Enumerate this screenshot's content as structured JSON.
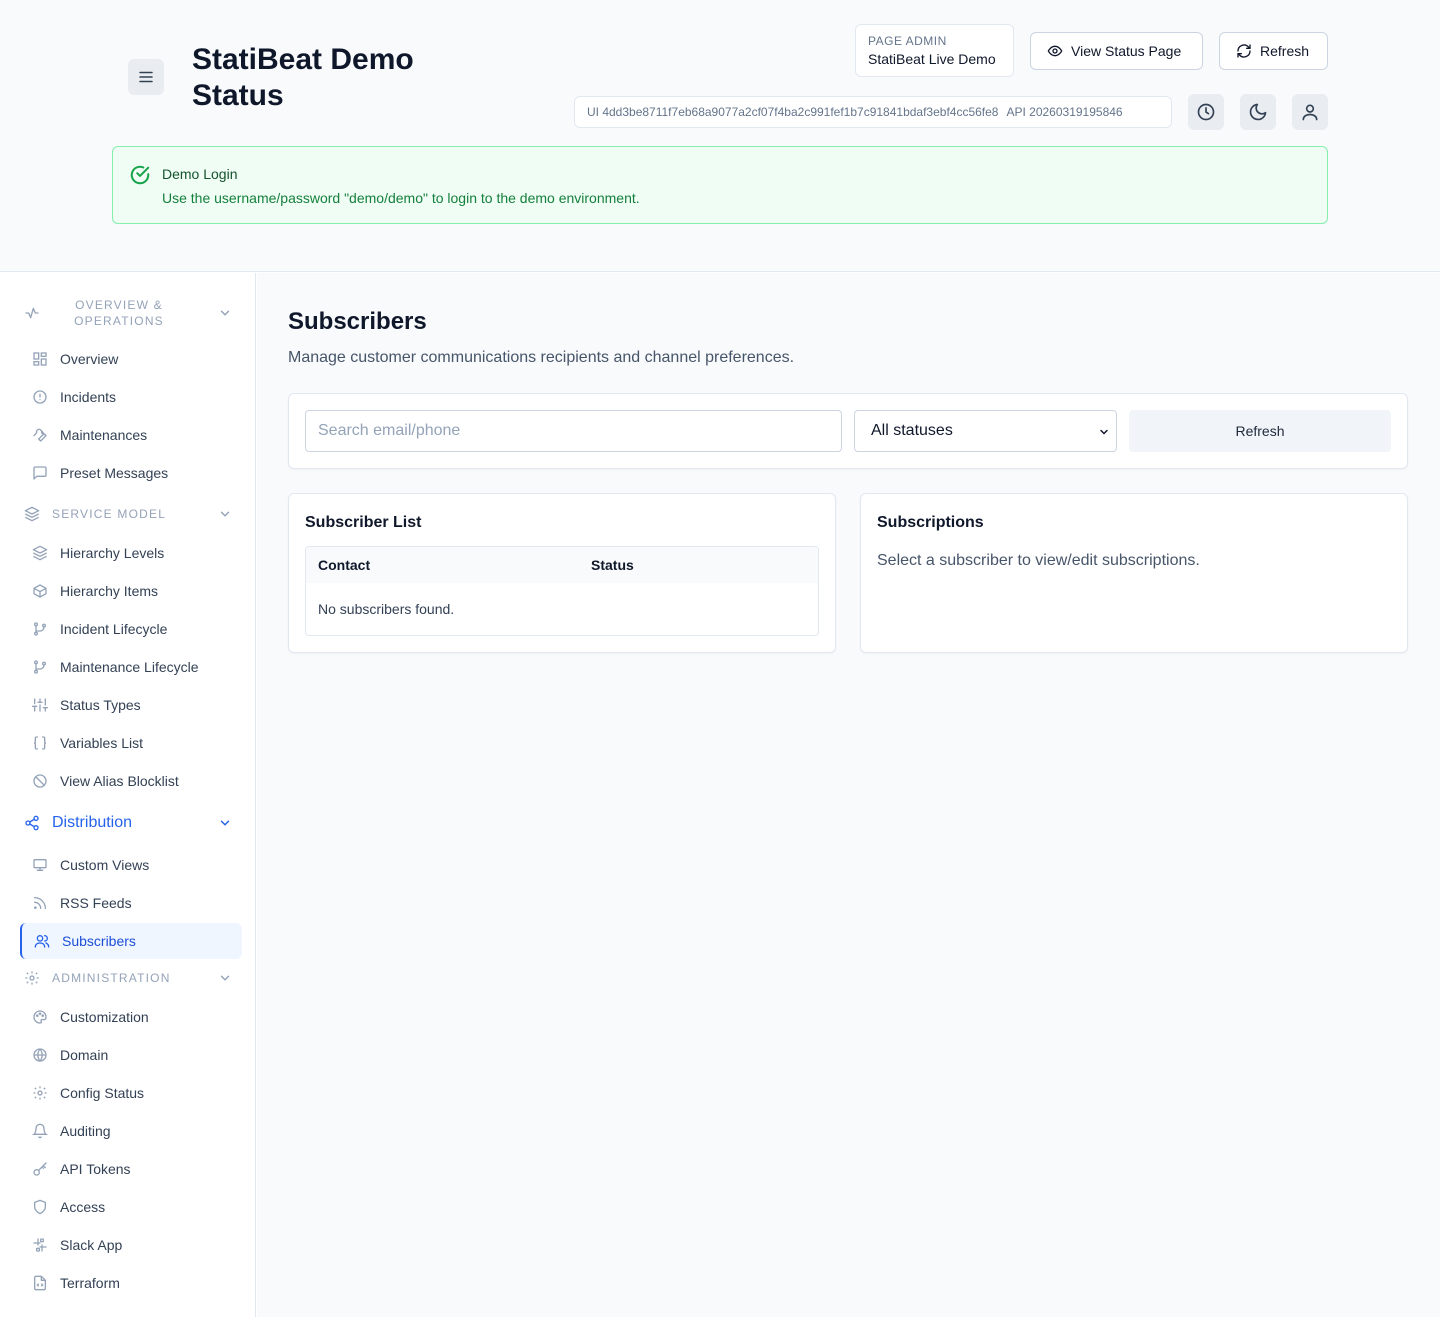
{
  "header": {
    "title": "StatiBeat Demo Status",
    "page_admin_label": "PAGE ADMIN",
    "page_admin_value": "StatiBeat Live Demo",
    "view_status_page": "View Status Page",
    "refresh": "Refresh",
    "ui_version": "UI 4dd3be8711f7eb68a9077a2cf07f4ba2c991fef1b7c91841bdaf3ebf4cc56fe8",
    "api_version": "API 20260319195846"
  },
  "alert": {
    "title": "Demo Login",
    "text": "Use the username/password \"demo/demo\" to login to the demo environment."
  },
  "sidebar": {
    "sections": [
      {
        "label": "OVERVIEW & OPERATIONS",
        "icon": "activity-icon",
        "items": [
          {
            "label": "Overview",
            "icon": "dashboard-icon"
          },
          {
            "label": "Incidents",
            "icon": "alert-circle-icon"
          },
          {
            "label": "Maintenances",
            "icon": "wrench-icon"
          },
          {
            "label": "Preset Messages",
            "icon": "message-square-icon"
          }
        ]
      },
      {
        "label": "SERVICE MODEL",
        "icon": "layers-icon",
        "items": [
          {
            "label": "Hierarchy Levels",
            "icon": "layers-icon"
          },
          {
            "label": "Hierarchy Items",
            "icon": "box-icon"
          },
          {
            "label": "Incident Lifecycle",
            "icon": "git-branch-icon"
          },
          {
            "label": "Maintenance Lifecycle",
            "icon": "git-branch-icon"
          },
          {
            "label": "Status Types",
            "icon": "sliders-icon"
          },
          {
            "label": "Variables List",
            "icon": "braces-icon"
          },
          {
            "label": "View Alias Blocklist",
            "icon": "ban-icon"
          }
        ]
      },
      {
        "label": "Distribution",
        "icon": "share-icon",
        "items": [
          {
            "label": "Custom Views",
            "icon": "monitor-icon"
          },
          {
            "label": "RSS Feeds",
            "icon": "rss-icon"
          },
          {
            "label": "Subscribers",
            "icon": "users-icon"
          }
        ]
      },
      {
        "label": "ADMINISTRATION",
        "icon": "settings-icon",
        "items": [
          {
            "label": "Customization",
            "icon": "palette-icon"
          },
          {
            "label": "Domain",
            "icon": "globe-icon"
          },
          {
            "label": "Config Status",
            "icon": "settings-icon"
          },
          {
            "label": "Auditing",
            "icon": "bell-icon"
          },
          {
            "label": "API Tokens",
            "icon": "key-icon"
          },
          {
            "label": "Access",
            "icon": "shield-icon"
          },
          {
            "label": "Slack App",
            "icon": "slack-icon"
          },
          {
            "label": "Terraform",
            "icon": "file-code-icon"
          }
        ]
      }
    ],
    "active_item": "Subscribers"
  },
  "main": {
    "title": "Subscribers",
    "subtitle": "Manage customer communications recipients and channel preferences.",
    "search_placeholder": "Search email/phone",
    "status_filter": "All statuses",
    "refresh": "Refresh",
    "list_title": "Subscriber List",
    "columns": [
      "Contact",
      "Status"
    ],
    "empty_text": "No subscribers found.",
    "subs_title": "Subscriptions",
    "subs_text": "Select a subscriber to view/edit subscriptions."
  },
  "colors": {
    "accent": "#2563eb",
    "success_bg": "#f0fdf4",
    "success_border": "#86efac"
  }
}
